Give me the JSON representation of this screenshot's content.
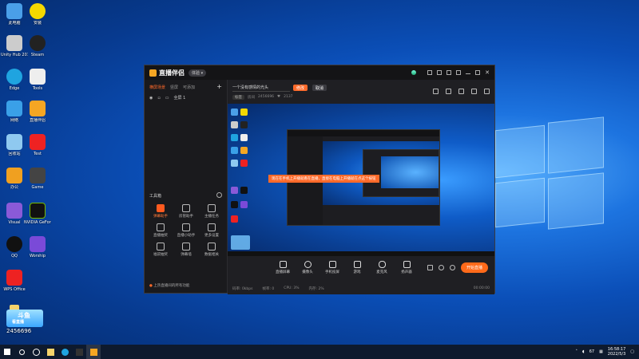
{
  "app": {
    "title": "直播伴侣",
    "version_badge": "体验 ▾",
    "left_tabs": [
      "横屏场景",
      "竖屏",
      "可添加"
    ],
    "scene_name": "全屏 1",
    "tools_header": "工具箱",
    "tools": [
      "弹幕助手",
      "房管助手",
      "主播任务",
      "直播抽奖",
      "直播小助手",
      "更多设置",
      "福袋抽奖",
      "弹幕墙",
      "数据相关"
    ],
    "left_tip": "上热直播间的所有功能",
    "title_input": "一个没有感情的光头",
    "btn_modify": "修改",
    "btn_cancel": "取消",
    "meta_tag": "标签",
    "meta_room": "房间",
    "meta_id": "2456696",
    "meta_fans": "2137",
    "preview_banner": "现在在手机上开播就看在直播，直接在电脑上开播就在点这个按钮",
    "bottom_tools": [
      "直播屏幕",
      "摄像头",
      "手机投屏",
      "游戏",
      "麦克风",
      "扬声器"
    ],
    "go_live": "开始直播",
    "status": [
      "码率: 0kbps",
      "帧率: 0",
      "CPU: 3%",
      "内存: 2%"
    ],
    "status_time": "00:00:00"
  },
  "desktop": {
    "icons": [
      "此电脑",
      "安装",
      "Unity Hub 2019",
      "Steam",
      "Edge",
      "Tools",
      "网络",
      "直播伴侣",
      "回收站",
      "Test",
      "办公",
      "Game",
      "Visual",
      "NVIDIA GeForce",
      "QQ",
      "Worship",
      "WPS Office"
    ],
    "watermark_brand": "斗鱼",
    "watermark_sub": "看直播",
    "watermark_id": "2456696"
  },
  "taskbar": {
    "time": "16:58:17",
    "date": "2022/5/3",
    "tray_text": "67"
  }
}
